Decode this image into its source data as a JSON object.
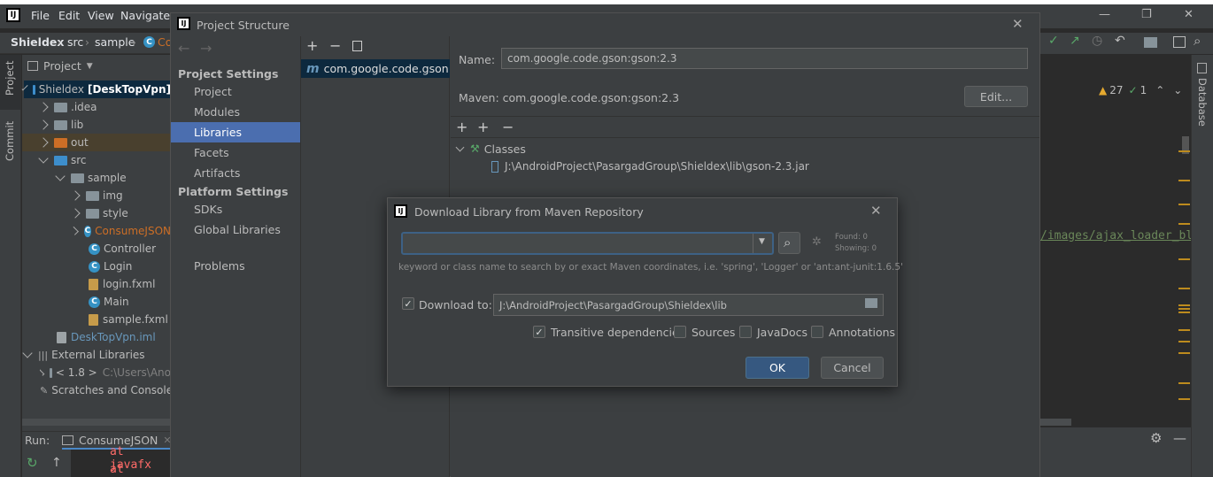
{
  "ide": {
    "logo": "IJ",
    "menu": [
      "File",
      "Edit",
      "View",
      "Navigate"
    ],
    "breadcrumb": [
      "Shieldex",
      "src",
      "sample",
      "Co"
    ],
    "window_controls": {
      "minimize": "—",
      "restore": "❐",
      "close": "✕"
    },
    "left_stripe": [
      "Project",
      "Commit"
    ],
    "right_stripe": "Database",
    "project_panel_title": "Project",
    "tree": [
      {
        "label": "Shieldex",
        "suffix": "[DeskTopVpn]"
      },
      {
        "label": ".idea"
      },
      {
        "label": "lib"
      },
      {
        "label": "out"
      },
      {
        "label": "src"
      },
      {
        "label": "sample"
      },
      {
        "label": "img"
      },
      {
        "label": "style"
      },
      {
        "label": "ConsumeJSON"
      },
      {
        "label": "Controller"
      },
      {
        "label": "Login"
      },
      {
        "label": "login.fxml"
      },
      {
        "label": "Main"
      },
      {
        "label": "sample.fxml"
      },
      {
        "label": "DeskTopVpn.iml"
      },
      {
        "label": "External Libraries"
      },
      {
        "label": "< 1.8 >",
        "suffix": "C:\\Users\\Ano"
      },
      {
        "label": "Scratches and Consoles"
      }
    ],
    "run": {
      "label": "Run:",
      "tab": "ConsumeJSON",
      "console": [
        "at javafx",
        "at javafx"
      ]
    },
    "inspections": {
      "warnings": "27",
      "checks": "1"
    },
    "editor_link": "/images/ajax_loader_bl"
  },
  "project_structure": {
    "title": "Project Structure",
    "nav": {
      "project_settings_header": "Project Settings",
      "project_settings": [
        "Project",
        "Modules",
        "Libraries",
        "Facets",
        "Artifacts"
      ],
      "platform_settings_header": "Platform Settings",
      "platform_settings": [
        "SDKs",
        "Global Libraries"
      ],
      "problems": "Problems"
    },
    "library_item": "com.google.code.gson:gsc",
    "name_label": "Name:",
    "name_value": "com.google.code.gson:gson:2.3",
    "maven_label": "Maven: com.google.code.gson:gson:2.3",
    "edit_button": "Edit...",
    "classes_label": "Classes",
    "jar_path": "J:\\AndroidProject\\PasargadGroup\\Shieldex\\lib\\gson-2.3.jar"
  },
  "download_dialog": {
    "title": "Download Library from Maven Repository",
    "search_value": "",
    "found": "Found: 0",
    "showing": "Showing: 0",
    "hint": "keyword or class name to search by or exact Maven coordinates, i.e. 'spring', 'Logger' or 'ant:ant-junit:1.6.5'",
    "download_to_label": "Download to:",
    "download_to_checked": true,
    "download_path": "J:\\AndroidProject\\PasargadGroup\\Shieldex\\lib",
    "options": [
      {
        "label": "Transitive dependencies",
        "checked": true
      },
      {
        "label": "Sources",
        "checked": false
      },
      {
        "label": "JavaDocs",
        "checked": false
      },
      {
        "label": "Annotations",
        "checked": false
      }
    ],
    "ok": "OK",
    "cancel": "Cancel"
  },
  "colors": {
    "selection": "#4b6eaf",
    "ok_button": "#365880",
    "warning": "#e5a92f"
  }
}
